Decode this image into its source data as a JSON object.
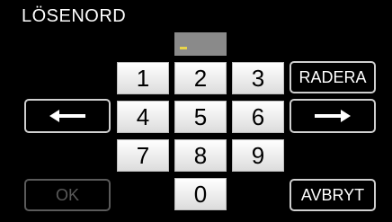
{
  "screen": {
    "title": "LÖSENORD"
  },
  "keypad": {
    "digits": [
      "1",
      "2",
      "3",
      "4",
      "5",
      "6",
      "7",
      "8",
      "9",
      "0"
    ]
  },
  "buttons": {
    "delete_label": "RADERA",
    "ok_label": "OK",
    "cancel_label": "AVBRYT"
  },
  "icons": {
    "left": "arrow-left-icon",
    "right": "arrow-right-icon"
  },
  "colors": {
    "cursor": "#e8d44a",
    "display_bg": "#8a8a8a"
  }
}
